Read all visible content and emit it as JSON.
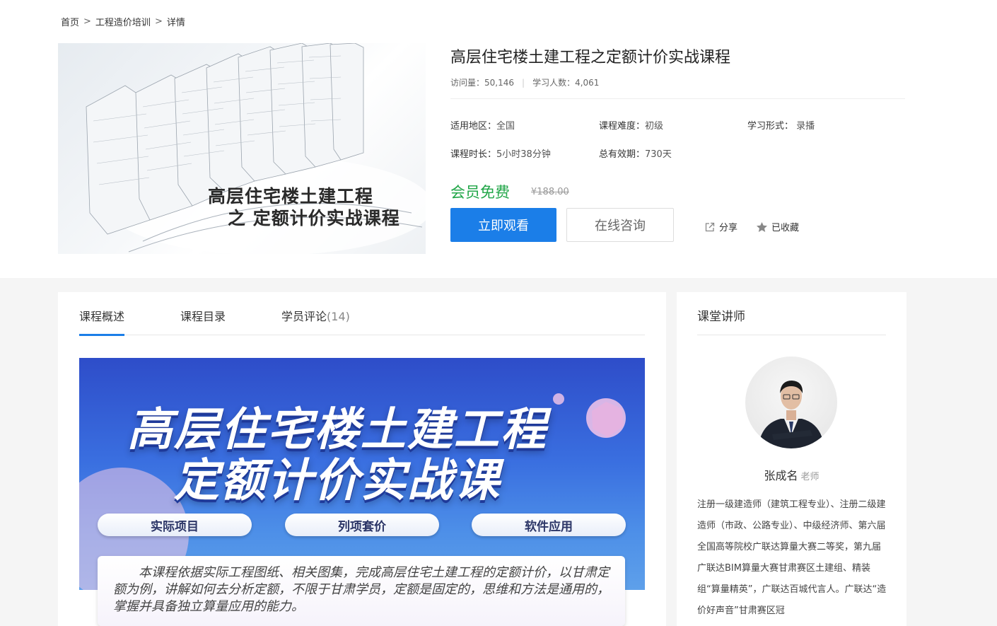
{
  "breadcrumb": {
    "home": "首页",
    "category": "工程造价培训",
    "current": "详情",
    "separator": ">"
  },
  "cover": {
    "line1": "高层住宅楼土建工程",
    "line2": "之 定额计价实战课程"
  },
  "course": {
    "title": "高层住宅楼土建工程之定额计价实战课程",
    "visits_label": "访问量：",
    "visits": "50,146",
    "learners_label": "学习人数：",
    "learners": "4,061",
    "region_label": "适用地区：",
    "region": "全国",
    "difficulty_label": "课程难度：",
    "difficulty": "初级",
    "format_label": "学习形式：",
    "format": " 录播",
    "duration_label": "课程时长：",
    "duration": "5小时38分钟",
    "validity_label": "总有效期：",
    "validity": "730天",
    "member_price": "会员免费",
    "original_price": "¥188.00",
    "watch_button": "立即观看",
    "consult_button": "在线咨询",
    "share_label": "分享",
    "favorite_label": "已收藏"
  },
  "tabs": [
    {
      "label": "课程概述"
    },
    {
      "label": "课程目录"
    },
    {
      "label": "学员评论",
      "count": "(14)"
    }
  ],
  "banner": {
    "title_line1": "高层住宅楼土建工程",
    "title_line2": "定额计价实战课",
    "pills": [
      "实际项目",
      "列项套价",
      "软件应用"
    ],
    "description": "本课程依据实际工程图纸、相关图集，完成高层住宅土建工程的定额计价，以甘肃定额为例，讲解如何去分析定额，不限于甘肃学员，定额是固定的，思维和方法是通用的，掌握并具备独立算量应用的能力。"
  },
  "teacher": {
    "section_title": "课堂讲师",
    "name": "张成名",
    "role": "老师",
    "bio": "注册一级建造师（建筑工程专业）、注册二级建造师（市政、公路专业）、中级经济师、第六届全国高等院校广联达算量大赛二等奖，第九届广联达BIM算量大赛甘肃赛区土建组、精装组“算量精英”，广联达百城代言人。广联达“造价好声音”甘肃赛区冠"
  },
  "colors": {
    "primary": "#1b7ee8",
    "member_green": "#21a648",
    "banner_blue": "#3a6fe0"
  }
}
